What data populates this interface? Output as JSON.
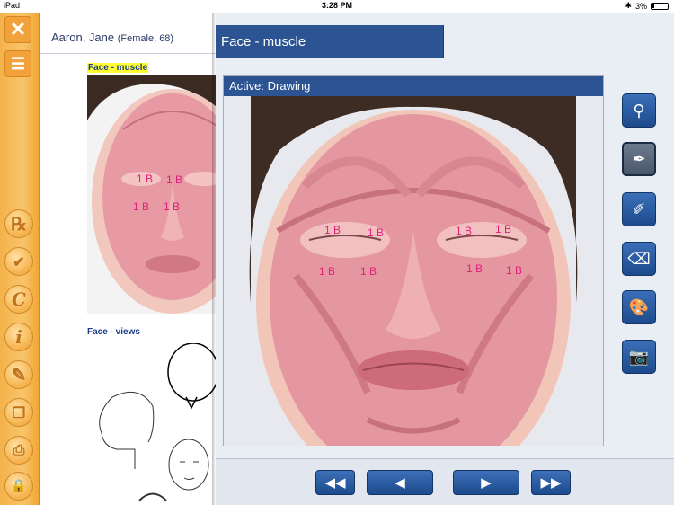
{
  "status_bar": {
    "carrier": "iPad",
    "time": "3:28 PM",
    "battery": "3%"
  },
  "sidebar": {
    "items": [
      {
        "icon": "close-icon",
        "glyph": "✕"
      },
      {
        "icon": "list-icon",
        "glyph": "☰"
      },
      {
        "icon": "rx-icon",
        "glyph": "℞"
      },
      {
        "icon": "clipboard-check-icon",
        "glyph": "✔"
      },
      {
        "icon": "c-icon",
        "glyph": "C"
      },
      {
        "icon": "info-icon",
        "glyph": "i"
      },
      {
        "icon": "pencil-icon",
        "glyph": "✎"
      },
      {
        "icon": "pages-icon",
        "glyph": "❐"
      },
      {
        "icon": "printer-icon",
        "glyph": "⎙"
      },
      {
        "icon": "lock-icon",
        "glyph": "🔒"
      }
    ]
  },
  "document": {
    "patient_name": "Aaron, Jane",
    "patient_info": "(Female, 68)",
    "section1_label": "Face - muscle",
    "section2_label": "Face - views",
    "thumb_markers": [
      "1 B",
      "1 B",
      "1 B",
      "1 B"
    ]
  },
  "panel": {
    "title": "Face - muscle",
    "active_label": "Active: Drawing",
    "markers": [
      "1 B",
      "1 B",
      "1 B",
      "1 B",
      "1 B",
      "1 B",
      "1 B",
      "1 B"
    ],
    "tools": [
      {
        "name": "stamp-tool",
        "icon": "stamp-icon",
        "glyph": "⚲"
      },
      {
        "name": "pen-tool",
        "icon": "pen-icon",
        "glyph": "✒",
        "active": true
      },
      {
        "name": "ruler-pencil-tool",
        "icon": "ruler-pencil-icon",
        "glyph": "✐"
      },
      {
        "name": "eraser-tool",
        "icon": "eraser-icon",
        "glyph": "⌫"
      },
      {
        "name": "palette-tool",
        "icon": "palette-icon",
        "glyph": "🎨"
      },
      {
        "name": "camera-tool",
        "icon": "camera-icon",
        "glyph": "📷"
      }
    ],
    "nav": [
      {
        "name": "first-button",
        "icon": "rewind-icon",
        "glyph": "◀◀"
      },
      {
        "name": "previous-button",
        "icon": "back-arrow-icon",
        "glyph": "◀"
      },
      {
        "name": "next-button",
        "icon": "forward-arrow-icon",
        "glyph": "▶"
      },
      {
        "name": "last-button",
        "icon": "fast-forward-icon",
        "glyph": "▶▶"
      }
    ]
  },
  "colors": {
    "sidebar": "#f4b24a",
    "panel_header": "#2c5493",
    "marker": "#e0207a"
  }
}
